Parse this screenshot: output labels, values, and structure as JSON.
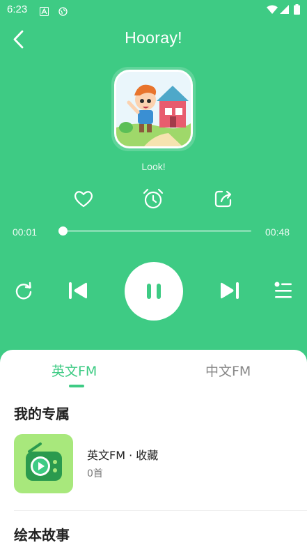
{
  "status_bar": {
    "time": "6:23",
    "notification_icons": [
      "font-app-icon",
      "vpn-globe-icon"
    ]
  },
  "header": {
    "title": "Hooray!"
  },
  "player": {
    "track_subtitle": "Look!",
    "elapsed": "00:01",
    "duration": "00:48",
    "progress_fraction": 0.02,
    "is_playing": true,
    "accent_color": "#3ecb84"
  },
  "sheet": {
    "tabs": [
      {
        "label": "英文FM",
        "active": true
      },
      {
        "label": "中文FM",
        "active": false
      }
    ],
    "sections": [
      {
        "title": "我的专属"
      },
      {
        "title": "绘本故事"
      }
    ],
    "album": {
      "name": "英文FM · 收藏",
      "count": "0首"
    }
  }
}
